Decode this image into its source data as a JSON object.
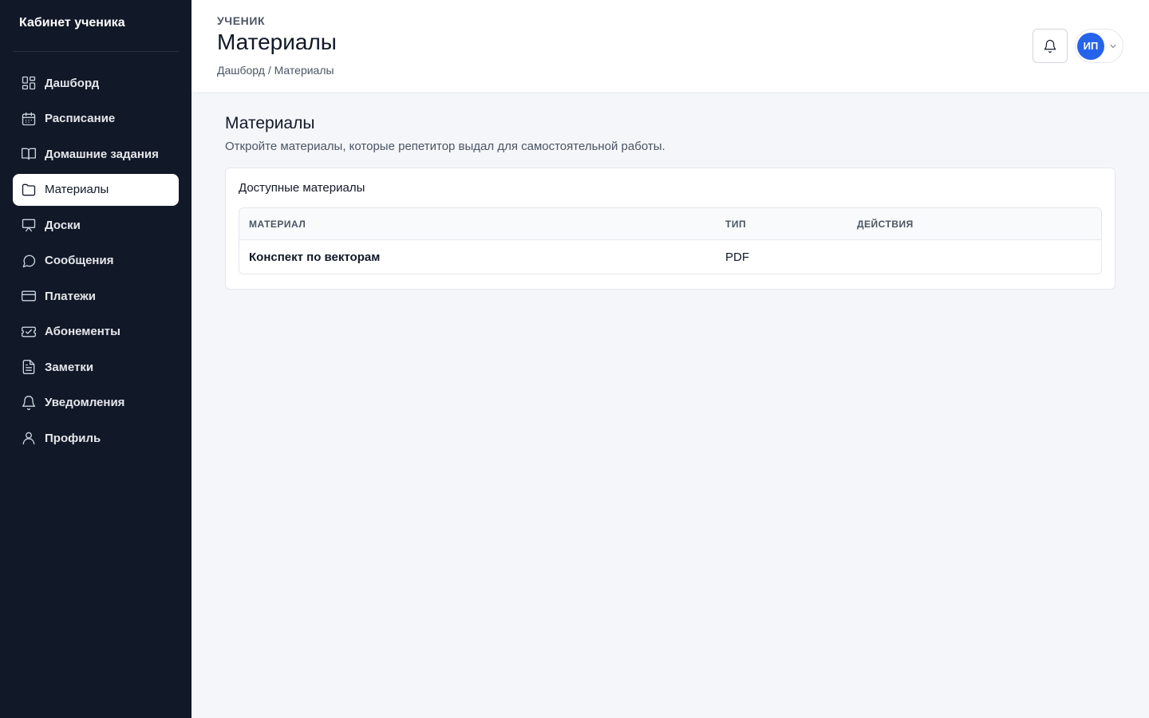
{
  "sidebar": {
    "brand": "Кабинет ученика",
    "items": [
      {
        "label": "Дашборд",
        "icon": "dashboard-icon"
      },
      {
        "label": "Расписание",
        "icon": "calendar-icon"
      },
      {
        "label": "Домашние задания",
        "icon": "book-icon"
      },
      {
        "label": "Материалы",
        "icon": "folder-icon",
        "active": true
      },
      {
        "label": "Доски",
        "icon": "whiteboard-icon"
      },
      {
        "label": "Сообщения",
        "icon": "chat-icon"
      },
      {
        "label": "Платежи",
        "icon": "credit-card-icon"
      },
      {
        "label": "Абонементы",
        "icon": "ticket-icon"
      },
      {
        "label": "Заметки",
        "icon": "document-icon"
      },
      {
        "label": "Уведомления",
        "icon": "bell-icon"
      },
      {
        "label": "Профиль",
        "icon": "user-icon"
      }
    ]
  },
  "header": {
    "role": "УЧЕНИК",
    "title": "Материалы",
    "breadcrumb": "Дашборд / Материалы",
    "notifications_icon": "bell-icon",
    "avatar_initials": "ИП"
  },
  "main": {
    "title": "Материалы",
    "description": "Откройте материалы, которые репетитор выдал для самостоятельной работы.",
    "card": {
      "title": "Доступные материалы",
      "columns": [
        "МАТЕРИАЛ",
        "ТИП",
        "ДЕЙСТВИЯ"
      ],
      "rows": [
        {
          "material": "Конспект по векторам",
          "type": "PDF",
          "actions": ""
        }
      ]
    }
  },
  "colors": {
    "sidebar_bg": "#111827",
    "accent": "#2563eb",
    "page_bg": "#f4f6fa"
  }
}
